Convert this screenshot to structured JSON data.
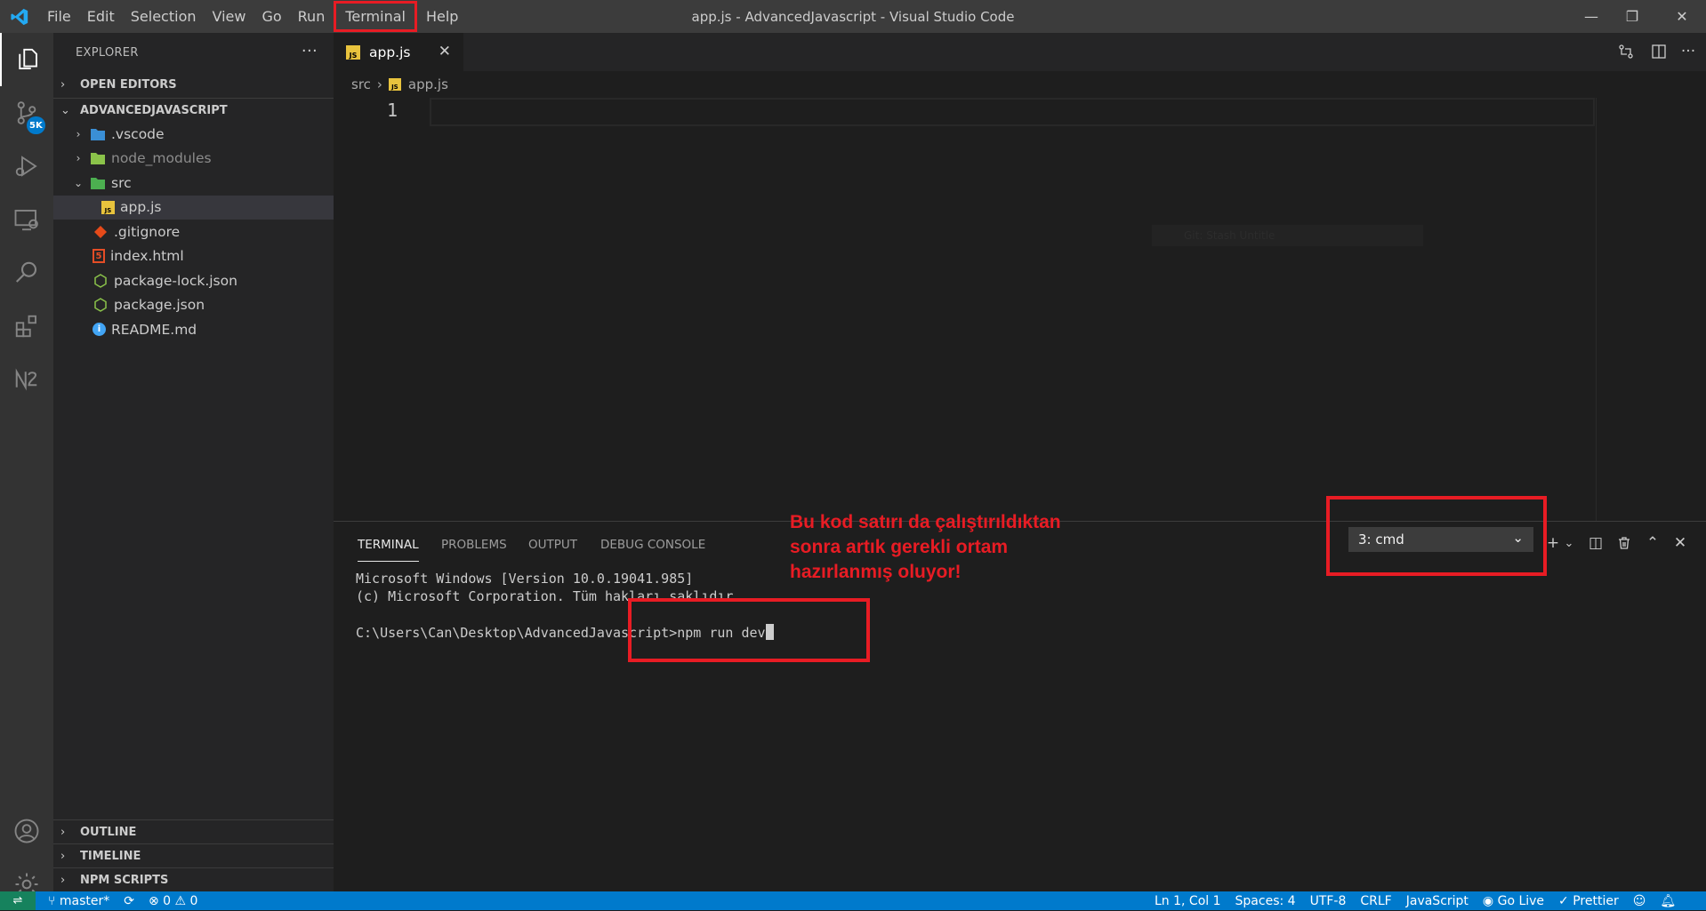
{
  "window": {
    "title": "app.js - AdvancedJavascript - Visual Studio Code",
    "menu": [
      "File",
      "Edit",
      "Selection",
      "View",
      "Go",
      "Run",
      "Terminal",
      "Help"
    ],
    "controls": {
      "minimize": "—",
      "restore": "❐",
      "close": "✕"
    }
  },
  "activity_bar": {
    "items": [
      "explorer",
      "source-control",
      "run-debug",
      "remote-explorer",
      "search",
      "extensions",
      "nx-console"
    ],
    "scm_badge": "5K",
    "bottom": [
      "accounts",
      "manage"
    ]
  },
  "sidebar": {
    "title": "EXPLORER",
    "more": "···",
    "open_editors": "OPEN EDITORS",
    "project": "ADVANCEDJAVASCRIPT",
    "tree": [
      {
        "label": ".vscode",
        "kind": "folder-vscode",
        "chev": "›"
      },
      {
        "label": "node_modules",
        "kind": "folder-node",
        "chev": "›"
      },
      {
        "label": "src",
        "kind": "folder-src",
        "chev": "⌄"
      },
      {
        "label": "app.js",
        "kind": "js",
        "icon_text": "JS"
      },
      {
        "label": ".gitignore",
        "kind": "git"
      },
      {
        "label": "index.html",
        "kind": "html",
        "icon_text": "5"
      },
      {
        "label": "package-lock.json",
        "kind": "json"
      },
      {
        "label": "package.json",
        "kind": "json"
      },
      {
        "label": "README.md",
        "kind": "info",
        "icon_text": "i"
      }
    ],
    "outline": "OUTLINE",
    "timeline": "TIMELINE",
    "npm_scripts": "NPM SCRIPTS"
  },
  "editor": {
    "tab_label": "app.js",
    "tab_close": "✕",
    "js_icon_text": "JS",
    "breadcrumb": {
      "folder": "src",
      "file": "app.js",
      "sep": "›"
    },
    "line_number": "1",
    "hint": "Git: Stash Untitle"
  },
  "panel": {
    "tabs": [
      "TERMINAL",
      "PROBLEMS",
      "OUTPUT",
      "DEBUG CONSOLE"
    ],
    "terminal_selector": "3: cmd",
    "terminal_lines": [
      "Microsoft Windows [Version 10.0.19041.985]",
      "(c) Microsoft Corporation. Tüm hakları saklıdır.",
      "",
      "C:\\Users\\Can\\Desktop\\AdvancedJavascript>npm run dev"
    ],
    "icons": {
      "add": "+",
      "add_chev": "⌄",
      "split": "◫",
      "trash": "🗑",
      "maximize": "⌃",
      "close": "✕"
    }
  },
  "annotation": {
    "text": "Bu kod satırı da çalıştırıldıktan sonra artık gerekli ortam hazırlanmış oluyor!",
    "color": "#e81c24"
  },
  "status_bar": {
    "remote": "⇌",
    "branch": "master*",
    "sync": "⟳",
    "errors": "0",
    "warnings": "0",
    "position": "Ln 1, Col 1",
    "spaces": "Spaces: 4",
    "encoding": "UTF-8",
    "eol": "CRLF",
    "language": "JavaScript",
    "golive": "Go Live",
    "prettier": "Prettier",
    "color": "#007acc"
  }
}
